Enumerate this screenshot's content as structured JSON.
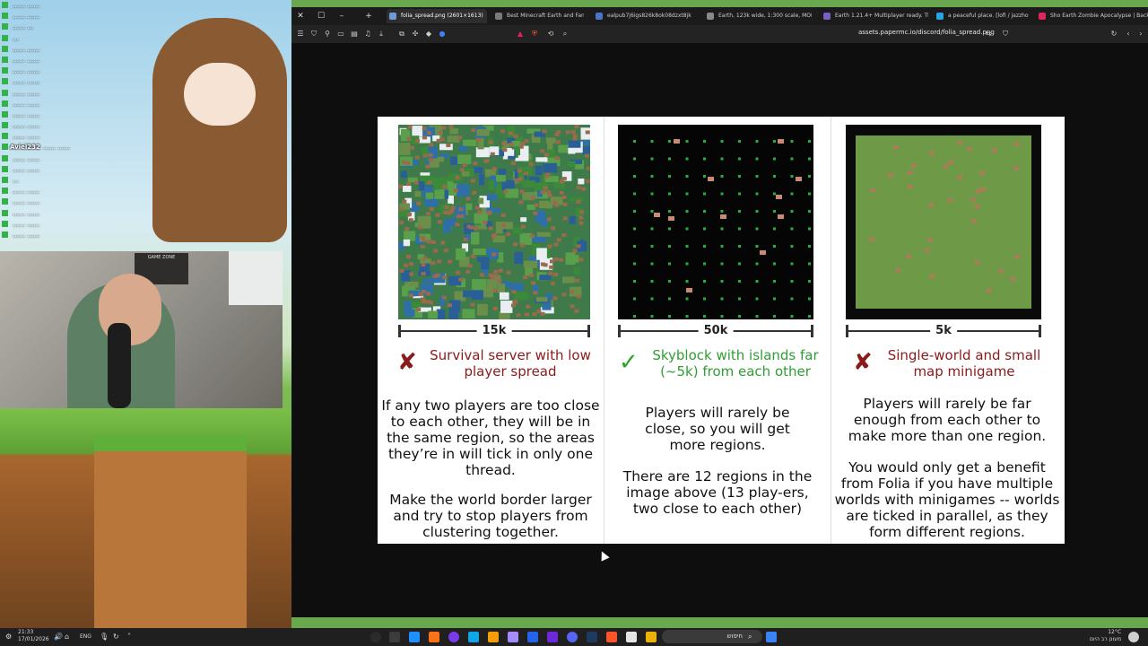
{
  "chat": {
    "lines": [
      {
        "name": "",
        "text": "…… ……"
      },
      {
        "name": "",
        "text": "…… ……"
      },
      {
        "name": "",
        "text": "…… …"
      },
      {
        "name": "",
        "text": "…"
      },
      {
        "name": "",
        "text": "…… ……"
      },
      {
        "name": "",
        "text": "…… ……"
      },
      {
        "name": "",
        "text": "…… ……"
      },
      {
        "name": "",
        "text": "…… ……"
      },
      {
        "name": "",
        "text": "…… ……"
      },
      {
        "name": "",
        "text": "…… ……"
      },
      {
        "name": "",
        "text": "…… ……"
      },
      {
        "name": "",
        "text": "…… ……"
      },
      {
        "name": "",
        "text": "…… ……"
      },
      {
        "name": "Aviel232",
        "text": "…… ……"
      },
      {
        "name": "",
        "text": "…… ……"
      },
      {
        "name": "",
        "text": "…… ……"
      },
      {
        "name": "",
        "text": "…"
      },
      {
        "name": "",
        "text": "…… ……"
      },
      {
        "name": "",
        "text": "…… ……"
      },
      {
        "name": "",
        "text": "…… ……"
      },
      {
        "name": "",
        "text": "…… ……"
      },
      {
        "name": "",
        "text": "…… ……"
      }
    ],
    "cam_poster": "GAME ZONE"
  },
  "browser": {
    "tabs": [
      {
        "label": "folia_spread.png (2601×1613)",
        "active": true,
        "color": "#6e9bd6"
      },
      {
        "label": "Best Minecraft Earth and Fantasy M",
        "active": false,
        "color": "#7a7a7a"
      },
      {
        "label": "ealpub7j6igs826k8ok08dzxt8jk (77...",
        "active": false,
        "color": "#4a73c9"
      },
      {
        "label": "Earth, 123k wide, 1:300 scale, MON",
        "active": false,
        "color": "#888888"
      },
      {
        "label": "Earth 1.21.4+ Multiplayer ready. The",
        "active": false,
        "color": "#7c5fc4"
      },
      {
        "label": "a peaceful place. [lofi / jazzhop",
        "active": false,
        "color": "#2aa3e3"
      },
      {
        "label": "Sho Earth Zombie Apocalypse | Back",
        "active": false,
        "color": "#e0245e"
      }
    ],
    "url": "assets.papermc.io/discord/folia_spread.png"
  },
  "figure": {
    "columns": [
      {
        "scale_label": "15k",
        "verdict_mark": "✘",
        "verdict_good": false,
        "verdict": "Survival server with low player spread",
        "desc": "If any two players are too close to each other, they will be in the same region, so the areas they’re in will tick in only one thread.",
        "desc2": "Make the world border larger and try to stop players from clustering together."
      },
      {
        "scale_label": "50k",
        "verdict_mark": "✓",
        "verdict_good": true,
        "verdict": "Skyblock with islands far (~5k) from each other",
        "desc": "Players will rarely be close, so you will get more regions.",
        "desc2": "There are 12 regions in the image above (13 play-ers, two close to each other)"
      },
      {
        "scale_label": "5k",
        "verdict_mark": "✘",
        "verdict_good": false,
        "verdict": "Single-world and small map minigame",
        "desc": "Players will rarely be far enough from each other to make more than one region.",
        "desc2": "You would only get a benefit from Folia if you have multiple worlds with minigames -- worlds are ticked in parallel, as they form different regions."
      }
    ],
    "colors": {
      "bad": "#8b1a1a",
      "good": "#2aa52a",
      "good_text": "#2f9e33"
    }
  },
  "taskbar": {
    "time": "21:33",
    "date": "17/01/2026",
    "lang": "ENG",
    "search_placeholder": "חיפוש",
    "weather_temp": "12°C",
    "weather_desc": "מעונן רב היום"
  }
}
